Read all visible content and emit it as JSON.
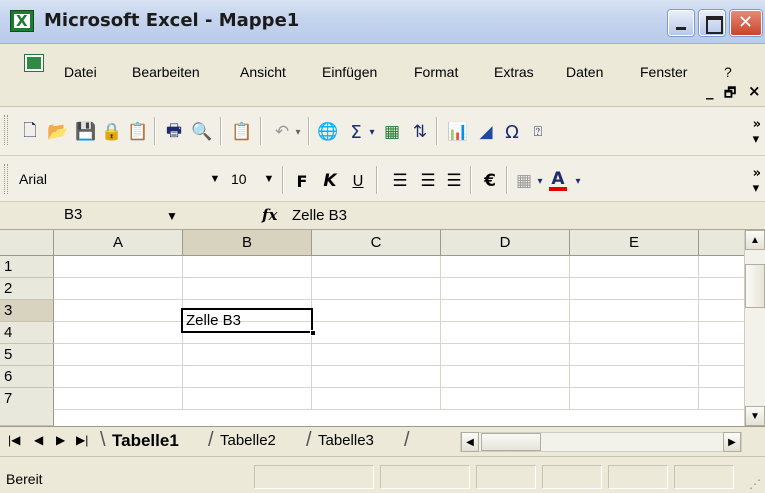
{
  "window": {
    "title": "Microsoft Excel - Mappe1"
  },
  "menu": {
    "items": [
      "Datei",
      "Bearbeiten",
      "Ansicht",
      "Einfügen",
      "Format",
      "Extras",
      "Daten",
      "Fenster",
      "?"
    ]
  },
  "toolbar_icons": [
    "new-document",
    "open-folder",
    "save",
    "permission",
    "research",
    "print",
    "print-preview",
    "paste",
    "undo",
    "hyperlink",
    "autosum",
    "insert-function",
    "sort-ascending",
    "chart-wizard",
    "drawing",
    "symbol",
    "help"
  ],
  "format_toolbar": {
    "font": "Arial",
    "size": "10",
    "bold": "F",
    "italic": "K",
    "underline": "U",
    "currency": "€",
    "font_color_letter": "A"
  },
  "formula_bar": {
    "name_box": "B3",
    "fx": "fx",
    "formula": "Zelle B3"
  },
  "grid": {
    "columns": [
      "A",
      "B",
      "C",
      "D",
      "E"
    ],
    "rows": [
      "1",
      "2",
      "3",
      "4",
      "5",
      "6",
      "7"
    ],
    "active_cell": {
      "col": "B",
      "row": "3",
      "value": "Zelle B3"
    }
  },
  "sheets": {
    "tabs": [
      "Tabelle1",
      "Tabelle2",
      "Tabelle3"
    ],
    "active": "Tabelle1"
  },
  "status": {
    "text": "Bereit"
  },
  "colors": {
    "title_gradient_top": "#d8e3f3",
    "close_button": "#c8452a",
    "excel_green": "#1f7a32",
    "font_color_bar": "#e00000"
  }
}
